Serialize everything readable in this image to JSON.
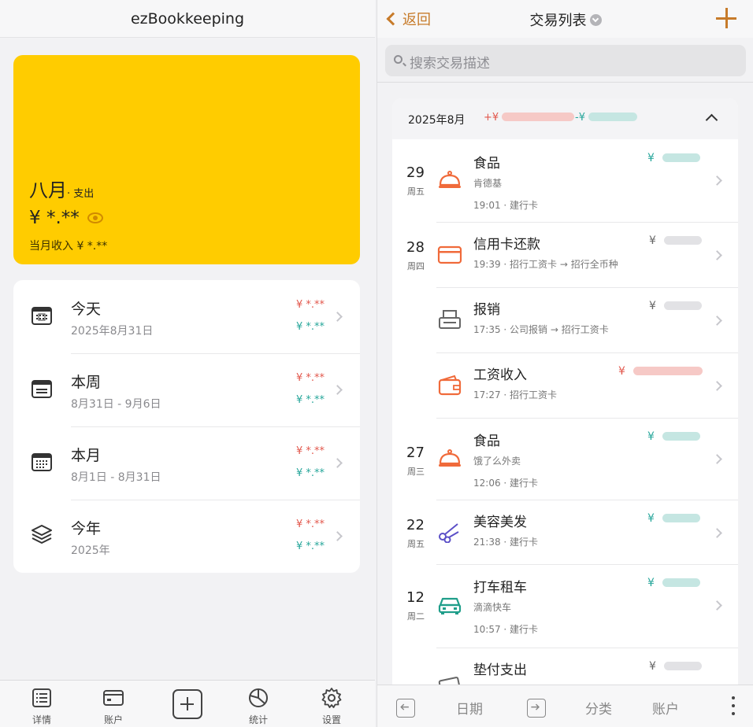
{
  "app": {
    "title": "ezBookkeeping"
  },
  "overview": {
    "month": "八月",
    "label_suffix": "· 支出",
    "expense": "¥ *.**",
    "income": "当月收入 ¥ *.**"
  },
  "periods": [
    {
      "name": "今天",
      "date": "2025年8月31日",
      "expense": "¥ *.**",
      "income": "¥ *.**"
    },
    {
      "name": "本周",
      "date": "8月31日 - 9月6日",
      "expense": "¥ *.**",
      "income": "¥ *.**"
    },
    {
      "name": "本月",
      "date": "8月1日 - 8月31日",
      "expense": "¥ *.**",
      "income": "¥ *.**"
    },
    {
      "name": "今年",
      "date": "2025年",
      "expense": "¥ *.**",
      "income": "¥ *.**"
    }
  ],
  "tabbar": {
    "details": "详情",
    "accounts": "账户",
    "stats": "统计",
    "settings": "设置"
  },
  "list": {
    "back": "返回",
    "title": "交易列表",
    "search_placeholder": "搜索交易描述",
    "group": {
      "month": "2025年8月",
      "income_prefix": "+¥",
      "expense_prefix": "-¥"
    },
    "transactions": [
      {
        "day": "29",
        "weekday": "周五",
        "name": "食品",
        "sub": "肯德基",
        "meta": "19:01 · 建行卡",
        "currency": "¥",
        "type": "expense",
        "icon": "food-icon"
      },
      {
        "day": "28",
        "weekday": "周四",
        "name": "信用卡还款",
        "meta": "19:39 · 招行工资卡 → 招行全币种",
        "currency": "¥",
        "type": "transfer",
        "icon": "credit-card-icon"
      },
      {
        "name": "报销",
        "meta": "17:35 · 公司报销 → 招行工资卡",
        "currency": "¥",
        "type": "transfer",
        "icon": "reimbursement-icon"
      },
      {
        "name": "工资收入",
        "meta": "17:27 · 招行工资卡",
        "currency": "¥",
        "type": "income",
        "icon": "wallet-icon"
      },
      {
        "day": "27",
        "weekday": "周三",
        "name": "食品",
        "sub": "饿了么外卖",
        "meta": "12:06 · 建行卡",
        "currency": "¥",
        "type": "expense",
        "icon": "food-icon"
      },
      {
        "day": "22",
        "weekday": "周五",
        "name": "美容美发",
        "meta": "21:38 · 建行卡",
        "currency": "¥",
        "type": "expense",
        "icon": "scissors-icon"
      },
      {
        "day": "12",
        "weekday": "周二",
        "name": "打车租车",
        "sub": "滴滴快车",
        "meta": "10:57 · 建行卡",
        "currency": "¥",
        "type": "expense",
        "icon": "taxi-icon"
      },
      {
        "name": "垫付支出",
        "currency": "¥",
        "type": "transfer",
        "icon": "advance-payment-icon"
      }
    ]
  },
  "toolbar": {
    "date": "日期",
    "category": "分类",
    "account": "账户"
  },
  "colors": {
    "accent": "#c77b2a",
    "card": "#ffcc00",
    "expense": "#26a69a",
    "income": "#e2574c",
    "transfer": "#666666"
  }
}
